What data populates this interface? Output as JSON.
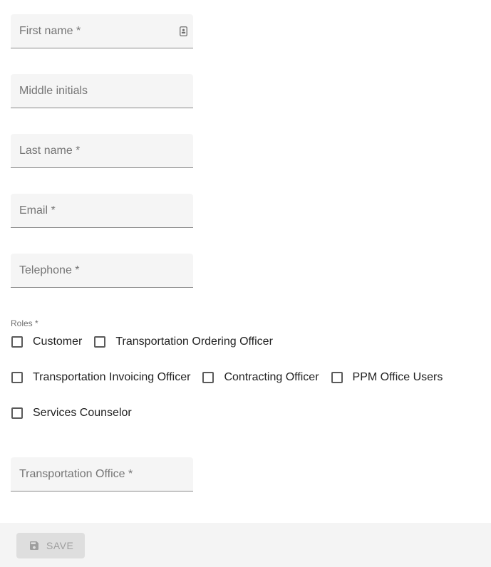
{
  "form": {
    "fields": {
      "first_name": {
        "placeholder": "First name *",
        "value": ""
      },
      "middle_initials": {
        "placeholder": "Middle initials",
        "value": ""
      },
      "last_name": {
        "placeholder": "Last name *",
        "value": ""
      },
      "email": {
        "placeholder": "Email *",
        "value": ""
      },
      "telephone": {
        "placeholder": "Telephone *",
        "value": ""
      },
      "transportation_office": {
        "placeholder": "Transportation Office *",
        "value": ""
      }
    },
    "roles": {
      "label": "Roles *",
      "options": [
        {
          "label": "Customer",
          "checked": false
        },
        {
          "label": "Transportation Ordering Officer",
          "checked": false
        },
        {
          "label": "Transportation Invoicing Officer",
          "checked": false
        },
        {
          "label": "Contracting Officer",
          "checked": false
        },
        {
          "label": "PPM Office Users",
          "checked": false
        },
        {
          "label": "Services Counselor",
          "checked": false
        }
      ]
    }
  },
  "toolbar": {
    "save_label": "SAVE",
    "save_disabled": true
  },
  "icons": {
    "first_name_adornment": "contact-card-icon",
    "save": "floppy-disk-icon"
  }
}
